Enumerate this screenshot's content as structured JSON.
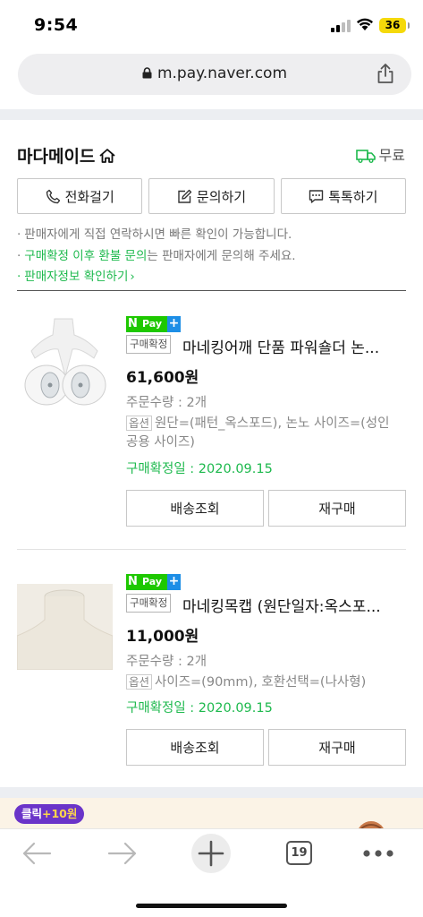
{
  "status": {
    "time": "9:54",
    "battery": "36"
  },
  "browser": {
    "url": "m.pay.naver.com",
    "tab_count": "19"
  },
  "seller": {
    "name": "마다메이드",
    "shipping_label": "무료",
    "buttons": {
      "call": "전화걸기",
      "inquiry": "문의하기",
      "talk": "톡톡하기"
    },
    "notice_1": "판매자에게 직접 연락하시면 빠른 확인이 가능합니다.",
    "notice_2_highlight": "구매확정 이후 환불 문의",
    "notice_2_rest": "는 판매자에게 문의해 주세요.",
    "notice_3": "판매자정보 확인하기",
    "notice_bullet": "·"
  },
  "npay": {
    "n": "N",
    "pay": "Pay",
    "plus": "+"
  },
  "products": [
    {
      "badge": "구매확정",
      "name": "마네킹어깨 단품 파워숄더 논...",
      "price": "61,600원",
      "quantity": "주문수량 : 2개",
      "option_tag": "옵션",
      "option": "원단=(패턴_옥스포드), 논노 사이즈=(성인 공용 사이즈)",
      "confirm_date": "구매확정일 : 2020.09.15",
      "btn_track": "배송조회",
      "btn_rebuy": "재구매"
    },
    {
      "badge": "구매확정",
      "name": "마네킹목캡 (원단일자:옥스포...",
      "price": "11,000원",
      "quantity": "주문수량 : 2개",
      "option_tag": "옵션",
      "option": "사이즈=(90mm), 호환선택=(나사형)",
      "confirm_date": "구매확정일 : 2020.09.15",
      "btn_track": "배송조회",
      "btn_rebuy": "재구매"
    }
  ],
  "ad": {
    "click_label": "클릭",
    "point_label": "+10원"
  },
  "colors": {
    "green": "#1db94d",
    "npay_green": "#1ec800",
    "npay_blue": "#1d8ee6",
    "ad_purple": "#6a34c9"
  }
}
